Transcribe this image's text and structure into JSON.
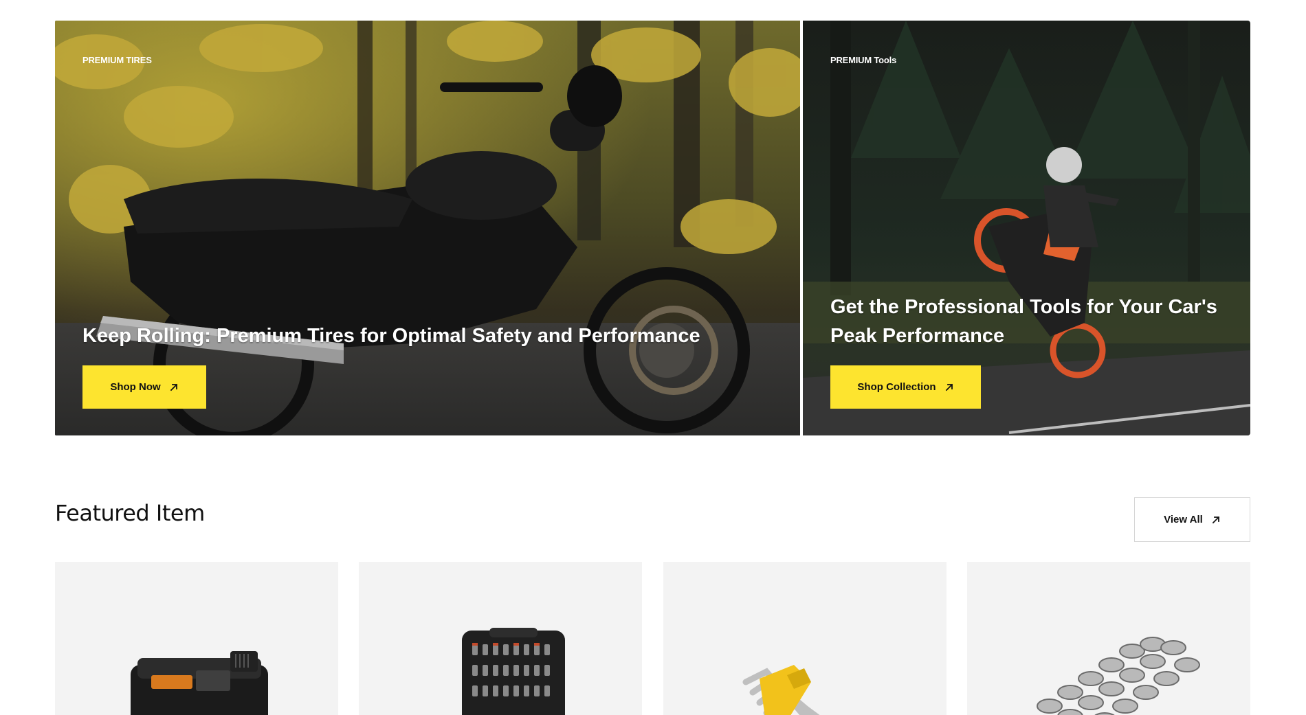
{
  "hero": {
    "tires": {
      "eyebrow": "PREMIUM TIRES",
      "title": "Keep Rolling: Premium Tires for Optimal Safety and Performance",
      "button_label": "Shop Now"
    },
    "tools": {
      "eyebrow": "PREMIUM Tools",
      "title": "Get the Professional Tools for Your Car's Peak Performance",
      "button_label": "Shop Collection"
    }
  },
  "featured": {
    "title": "Featured Item",
    "view_all_label": "View All",
    "products": [
      {
        "image": "tire-inflator-image"
      },
      {
        "image": "socket-set-image"
      },
      {
        "image": "hex-key-set-image"
      },
      {
        "image": "motorcycle-chain-image"
      }
    ]
  },
  "colors": {
    "accent_yellow": "#fde42f",
    "card_background": "#f3f3f3",
    "text_dark": "#111111"
  },
  "icons": {
    "button_arrow": "arrow-up-right-icon"
  }
}
